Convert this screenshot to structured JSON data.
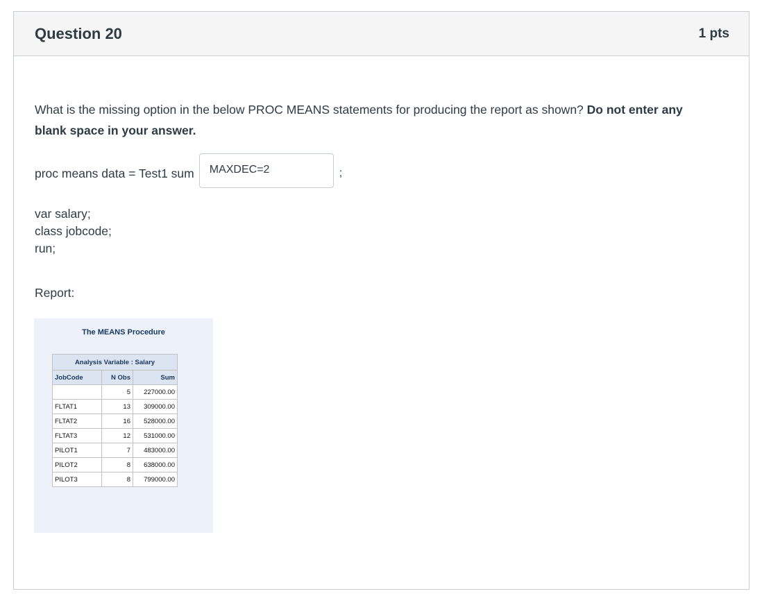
{
  "question": {
    "title": "Question 20",
    "points": "1 pts",
    "text_plain": "What is the missing option in the below PROC MEANS statements for producing the report as shown?",
    "text_bold": "Do not enter any blank space in your answer.",
    "proc_prefix": "proc means data = Test1 sum",
    "answer_value": "MAXDEC=2",
    "proc_suffix": ";",
    "code_lines": [
      "var salary;",
      "class jobcode;",
      "run;"
    ],
    "report_label": "Report:"
  },
  "report": {
    "title": "The MEANS Procedure",
    "table_caption": "Analysis Variable : Salary",
    "columns": [
      "JobCode",
      "N Obs",
      "Sum"
    ],
    "rows": [
      [
        "",
        "5",
        "227000.00"
      ],
      [
        "FLTAT1",
        "13",
        "309000.00"
      ],
      [
        "FLTAT2",
        "16",
        "528000.00"
      ],
      [
        "FLTAT3",
        "12",
        "531000.00"
      ],
      [
        "PILOT1",
        "7",
        "483000.00"
      ],
      [
        "PILOT2",
        "8",
        "638000.00"
      ],
      [
        "PILOT3",
        "8",
        "799000.00"
      ]
    ]
  }
}
